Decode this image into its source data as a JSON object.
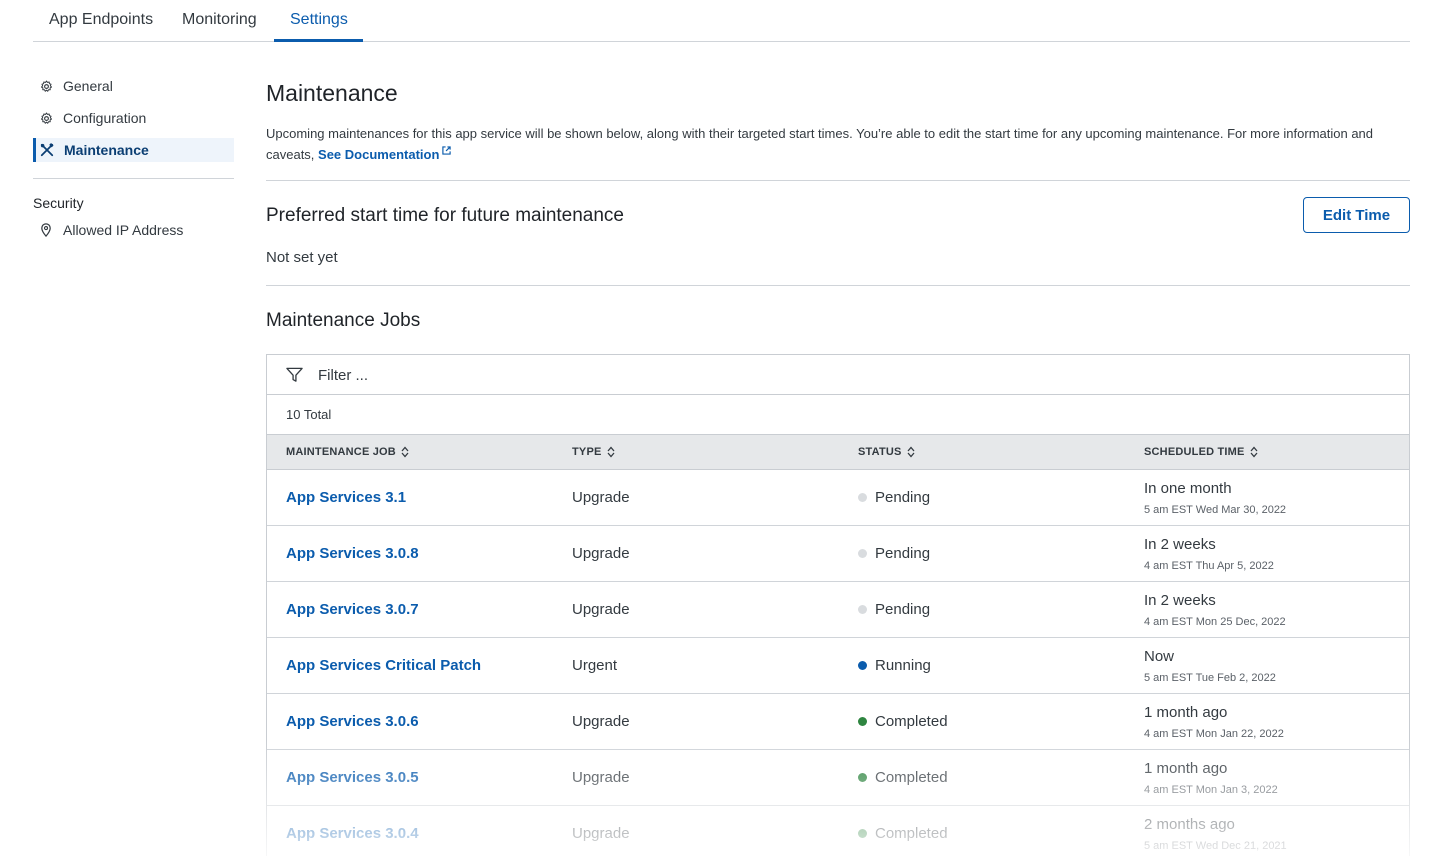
{
  "top_tabs": [
    {
      "label": "App Endpoints"
    },
    {
      "label": "Monitoring"
    },
    {
      "label": "Settings"
    }
  ],
  "sidebar": {
    "items": [
      {
        "label": "General",
        "icon": "gear-icon"
      },
      {
        "label": "Configuration",
        "icon": "gear-icon"
      },
      {
        "label": "Maintenance",
        "icon": "tools-icon",
        "active": true
      }
    ],
    "security_heading": "Security",
    "security_items": [
      {
        "label": "Allowed IP Address",
        "icon": "location-pin-icon"
      }
    ]
  },
  "main": {
    "title": "Maintenance",
    "description": "Upcoming maintenances for this app service will be shown below, along with their targeted start times. You’re able to edit the start time for any upcoming maintenance. For more information and caveats, ",
    "doc_link": "See Documentation",
    "preferred": {
      "title": "Preferred start time for future maintenance",
      "value": "Not set yet",
      "edit_label": "Edit Time"
    },
    "jobs_title": "Maintenance Jobs",
    "filter_placeholder": "Filter ...",
    "total": "10 Total",
    "columns": [
      "MAINTENANCE JOB",
      "TYPE",
      "STATUS",
      "SCHEDULED TIME"
    ],
    "rows": [
      {
        "job": "App Services 3.1",
        "type": "Upgrade",
        "status": "Pending",
        "time": "In one month",
        "time_detail": "5 am EST  Wed  Mar 30, 2022"
      },
      {
        "job": "App Services 3.0.8",
        "type": "Upgrade",
        "status": "Pending",
        "time": "In 2 weeks",
        "time_detail": "4 am EST  Thu  Apr 5, 2022"
      },
      {
        "job": "App Services 3.0.7",
        "type": "Upgrade",
        "status": "Pending",
        "time": "In 2 weeks",
        "time_detail": "4 am EST  Mon  25 Dec, 2022"
      },
      {
        "job": "App Services Critical Patch",
        "type": "Urgent",
        "status": "Running",
        "time": "Now",
        "time_detail": "5 am EST  Tue  Feb 2, 2022"
      },
      {
        "job": "App Services 3.0.6",
        "type": "Upgrade",
        "status": "Completed",
        "time": "1 month ago",
        "time_detail": "4 am EST  Mon  Jan 22, 2022"
      },
      {
        "job": "App Services 3.0.5",
        "type": "Upgrade",
        "status": "Completed",
        "time": "1 month ago",
        "time_detail": "4 am EST  Mon  Jan 3, 2022"
      },
      {
        "job": "App Services 3.0.4",
        "type": "Upgrade",
        "status": "Completed",
        "time": "2 months ago",
        "time_detail": "5 am EST  Wed  Dec 21, 2021"
      }
    ]
  },
  "colors": {
    "accent": "#0b5cad",
    "pending": "#d9dcdf",
    "running": "#0b5cad",
    "completed": "#2e8540"
  }
}
